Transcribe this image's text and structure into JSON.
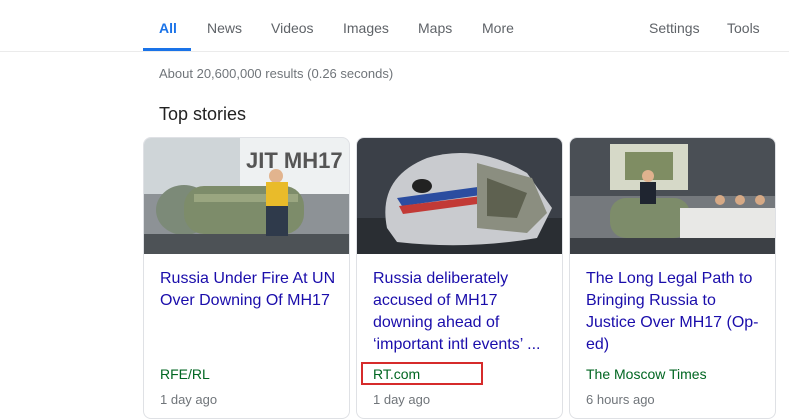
{
  "tabs": {
    "all": "All",
    "news": "News",
    "videos": "Videos",
    "images": "Images",
    "maps": "Maps",
    "more": "More",
    "settings": "Settings",
    "tools": "Tools"
  },
  "results_stats": "About 20,600,000 results (0.26 seconds)",
  "top_stories": {
    "title": "Top stories",
    "cards": [
      {
        "image_text": "JIT MH17",
        "headline": "Russia Under Fire At UN Over Downing Of MH17",
        "source": "RFE/RL",
        "age": "1 day ago"
      },
      {
        "headline": "Russia deliberately accused of MH17 downing ahead of ‘important intl events’ ...",
        "source": "RT.com",
        "age": "1 day ago"
      },
      {
        "headline": "The Long Legal Path to Bringing Russia to Justice Over MH17 (Op-ed)",
        "source": "The Moscow Times",
        "age": "6 hours ago"
      }
    ]
  },
  "colors": {
    "accent": "#1a73e8",
    "link": "#1a0dab",
    "source": "#006621",
    "highlight": "#d62b2b"
  }
}
